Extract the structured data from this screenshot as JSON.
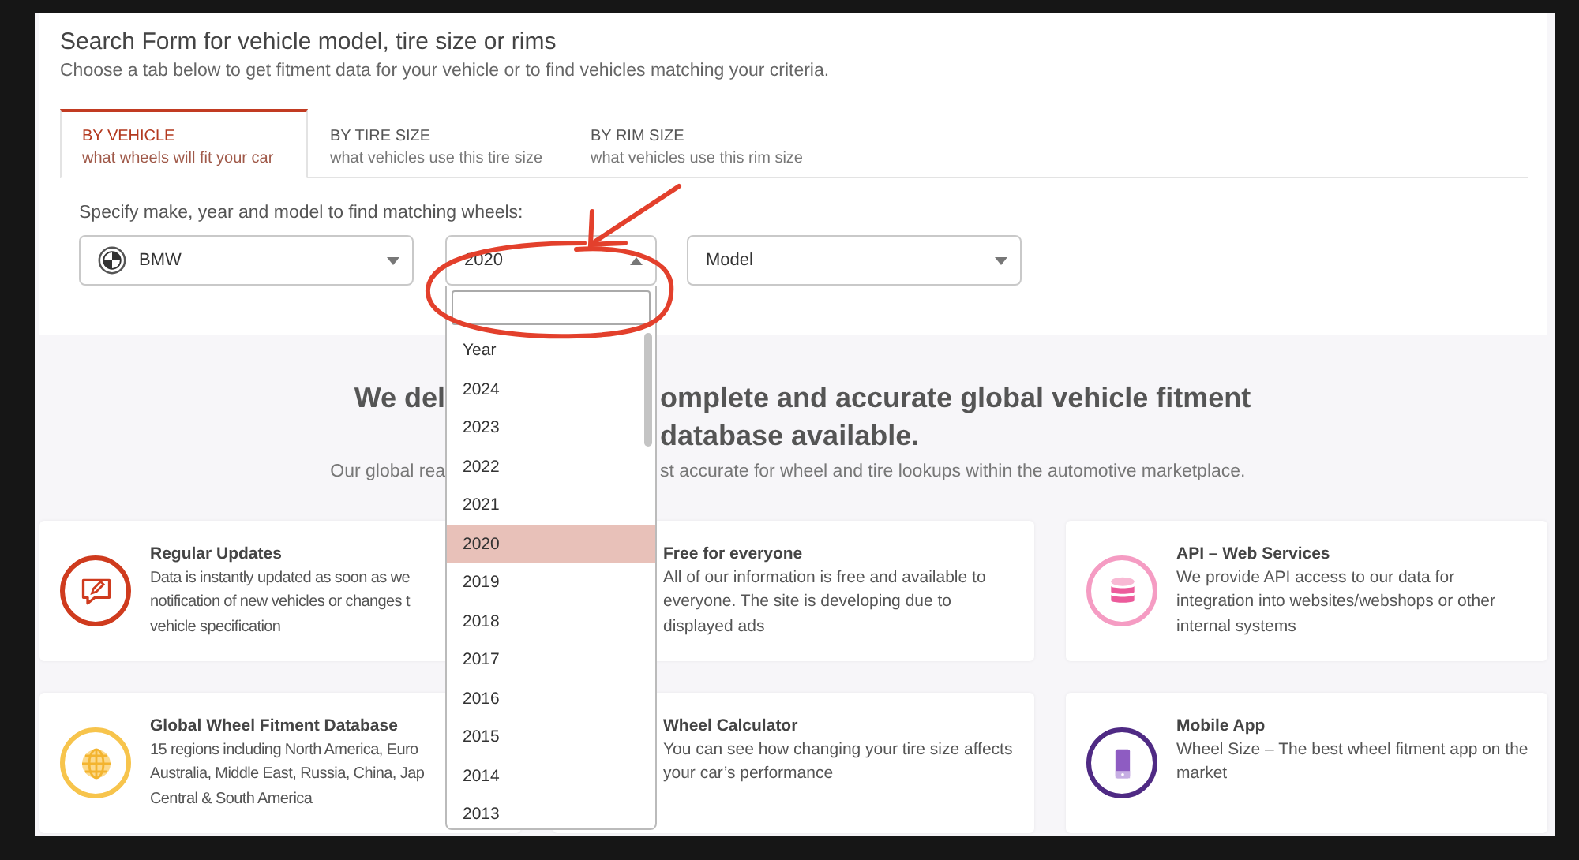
{
  "header": {
    "title": "Search Form for vehicle model, tire size or rims",
    "subtitle": "Choose a tab below to get fitment data for your vehicle or to find vehicles matching your criteria."
  },
  "tabs": [
    {
      "label": "BY VEHICLE",
      "sublabel": "what wheels will fit your car",
      "selected": true
    },
    {
      "label": "BY TIRE SIZE",
      "sublabel": "what vehicles use this tire size",
      "selected": false
    },
    {
      "label": "BY RIM SIZE",
      "sublabel": "what vehicles use this rim size",
      "selected": false
    }
  ],
  "form": {
    "prompt": "Specify make, year and model to find matching wheels:",
    "selects": [
      {
        "kind": "make",
        "value": "BMW",
        "expanded": false
      },
      {
        "kind": "year",
        "value": "2020",
        "expanded": true
      },
      {
        "kind": "plain",
        "value": "Model",
        "expanded": false
      }
    ]
  },
  "year_dropdown": {
    "items": [
      {
        "label": "Year",
        "selected": false
      },
      {
        "label": "2024",
        "selected": false
      },
      {
        "label": "2023",
        "selected": false
      },
      {
        "label": "2022",
        "selected": false
      },
      {
        "label": "2021",
        "selected": false
      },
      {
        "label": "2020",
        "selected": true
      },
      {
        "label": "2019",
        "selected": false
      },
      {
        "label": "2018",
        "selected": false
      },
      {
        "label": "2017",
        "selected": false
      },
      {
        "label": "2016",
        "selected": false
      },
      {
        "label": "2015",
        "selected": false
      },
      {
        "label": "2014",
        "selected": false
      },
      {
        "label": "2013",
        "selected": false
      }
    ]
  },
  "hero": {
    "heading_left": "We del",
    "heading_right": "omplete and accurate global vehicle fitment",
    "heading_line2": "database available.",
    "subtitle_left": "Our global rea",
    "subtitle_right": "st accurate for wheel and tire lookups within the automotive marketplace."
  },
  "features": [
    {
      "title": "Regular Updates",
      "lines": [
        "Data is instantly updated as soon as we",
        "notification of new vehicles or changes t",
        "vehicle specification"
      ]
    },
    {
      "title": "Free for everyone",
      "lines": [
        "All of our information is free and available to",
        "everyone. The site is developing due to",
        "displayed ads"
      ]
    },
    {
      "title": "API – Web Services",
      "lines": [
        "We provide API access to our data for",
        "integration into websites/webshops or other",
        "internal systems"
      ]
    },
    {
      "title": "Global Wheel Fitment Database",
      "lines": [
        "15 regions including North America, Euro",
        "Australia, Middle East, Russia, China, Jap",
        "Central & South America"
      ]
    },
    {
      "title": "Wheel Calculator",
      "lines": [
        "You can see how changing your tire size affects",
        "your car’s performance"
      ]
    },
    {
      "title": "Mobile App",
      "lines": [
        "Wheel Size – The best wheel fitment app on the",
        "market"
      ]
    }
  ]
}
